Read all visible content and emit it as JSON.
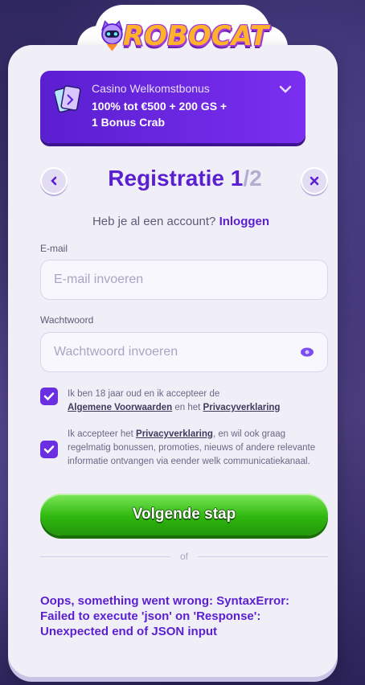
{
  "logo": {
    "text": "ROBOCAT"
  },
  "bonus": {
    "title": "Casino Welkomstbonus",
    "line1": "100% tot €500 + 200 GS +",
    "line2": "1 Bonus Crab"
  },
  "header": {
    "title": "Registratie",
    "step_current": "1",
    "step_total": "/2"
  },
  "login": {
    "prompt": "Heb je al een account?",
    "link": "Inloggen"
  },
  "form": {
    "email_label": "E-mail",
    "email_placeholder": "E-mail invoeren",
    "password_label": "Wachtwoord",
    "password_placeholder": "Wachtwoord invoeren"
  },
  "consent": {
    "age_text_1": "Ik ben 18 jaar oud en ik accepteer de",
    "age_link_terms": "Algemene Voorwaarden",
    "age_text_2": "en het",
    "age_link_privacy": "Privacyverklaring",
    "marketing_text_1": "Ik accepteer het",
    "marketing_link_privacy": "Privacyverklaring",
    "marketing_text_2": ", en wil ook graag regelmatig bonussen, promoties, nieuws of andere relevante informatie ontvangen via eender welk communicatiekanaal."
  },
  "cta": {
    "label": "Volgende stap"
  },
  "divider": {
    "label": "of"
  },
  "error": {
    "message": "Oops, something went wrong: SyntaxError: Failed to execute 'json' on 'Response': Unexpected end of JSON input"
  },
  "colors": {
    "accent": "#5a1fd0",
    "cta_green": "#2fb80f",
    "card_bg": "#f0eff8"
  }
}
